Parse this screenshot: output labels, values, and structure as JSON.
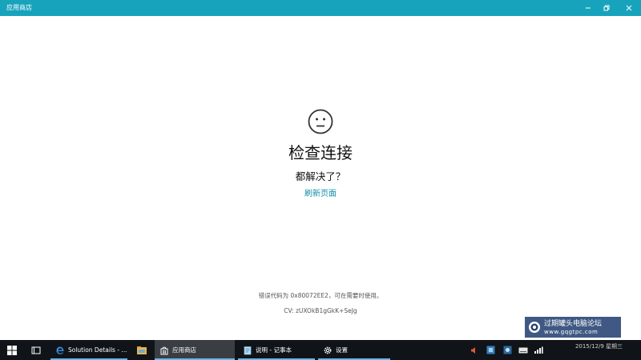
{
  "window": {
    "title": "应用商店"
  },
  "error_page": {
    "face_icon": "sad-face-icon",
    "heading": "检查连接",
    "subheading": "都解决了？",
    "refresh_link": "刷新页面",
    "error_code_text": "错误代码为 0x80072EE2，可在需要时使用。",
    "cv_text": "CV: zUXOkB1gGkK+SeJg"
  },
  "taskbar": {
    "apps": [
      {
        "label": "Solution Details - ...",
        "icon": "edge-icon"
      },
      {
        "label": "",
        "icon": "file-explorer-icon"
      },
      {
        "label": "应用商店",
        "icon": "store-icon"
      },
      {
        "label": "说明 - 记事本",
        "icon": "notepad-icon"
      },
      {
        "label": "设置",
        "icon": "settings-gear-icon"
      }
    ],
    "clock": {
      "time": "",
      "date": "2015/12/9 星期三"
    }
  },
  "watermark": {
    "line1": "过期罐头电脑论坛",
    "line2": "www.gqgtpc.com"
  },
  "colors": {
    "titlebar": "#18a3bd",
    "accent_link": "#0f8ea7",
    "taskbar": "#101418"
  }
}
